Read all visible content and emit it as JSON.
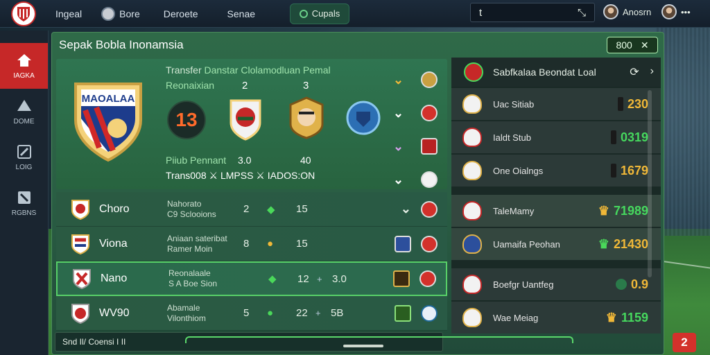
{
  "topbar": {
    "brand": "Ingeal",
    "nav": [
      "Bore",
      "Deroete",
      "Senae"
    ],
    "pill": "Cupals",
    "search_left": "t",
    "search_right": "⤡",
    "user1": "Anosrn",
    "user2": "•••"
  },
  "rail": {
    "items": [
      {
        "label": "IAGKA",
        "icon": "home-icon"
      },
      {
        "label": "DOME",
        "icon": "ball-icon"
      },
      {
        "label": "LOIG",
        "icon": "wrench-icon"
      },
      {
        "label": "RGBNS",
        "icon": "pencil-icon"
      }
    ]
  },
  "panel": {
    "title": "Sepak Bobla Inonamsia",
    "close_label": "800",
    "close_icon": "✕"
  },
  "hero": {
    "crest_text": "MAOALAA",
    "line1_a": "Transfer",
    "line1_b": "Danstar Clolamodluan Pemal",
    "line2_a": "Reonaixian",
    "col2": "2",
    "col3": "3",
    "number": "13",
    "line3_a": "Piiub Pennant",
    "line3_b": "3.0",
    "line3_c": "40",
    "line4": "Trans008  ⚔ LMPSS  ⚔ IADOS:ON"
  },
  "rows": [
    {
      "name": "Choro",
      "desc1": "Nahorato",
      "desc2": "C9  Sclooions",
      "n": "2",
      "sym": "◆",
      "val": "15",
      "sym2": "⋇",
      "val2": ""
    },
    {
      "name": "Viona",
      "desc1": "Aniaan sateribat",
      "desc2": "Ramer Moin",
      "n": "8",
      "sym": "●",
      "val": "15",
      "sym2": "⋇",
      "val2": ""
    },
    {
      "name": "Nano",
      "desc1": "Reonalaale",
      "desc2": "S A Boe Sion",
      "n": "",
      "sym": "◆",
      "val": "12",
      "sym2": "+",
      "val2": "3.0"
    },
    {
      "name": "WV90",
      "desc1": "Abamale",
      "desc2": "Vilonthiom",
      "n": "5",
      "sym": "●",
      "val": "22",
      "sym2": "+",
      "val2": "5B"
    }
  ],
  "board": {
    "title": "Sabfkalaa Beondat Loal",
    "rows": [
      {
        "name": "Uac Sitiab",
        "value": "230",
        "color": "yellow"
      },
      {
        "name": "Ialdt Stub",
        "value": "0319",
        "color": "green"
      },
      {
        "name": "One Oialngs",
        "value": "1679",
        "color": "yellow"
      },
      {
        "name": "TaleMamy",
        "value": "71989",
        "color": "green"
      },
      {
        "name": "Uamaifa Peohan",
        "value": "21430",
        "color": "yellow"
      },
      {
        "name": "Boefgr Uantfeg",
        "value": "0.9",
        "color": "yellow"
      },
      {
        "name": "Wae Meiag",
        "value": "1159",
        "color": "green"
      }
    ]
  },
  "bottom": {
    "label": "Snd Il/ Coensi I II",
    "badge": "2"
  },
  "colors": {
    "accent_red": "#c62828",
    "value_yellow": "#f0b838",
    "value_green": "#46d85e",
    "highlight_border": "#58d068"
  }
}
